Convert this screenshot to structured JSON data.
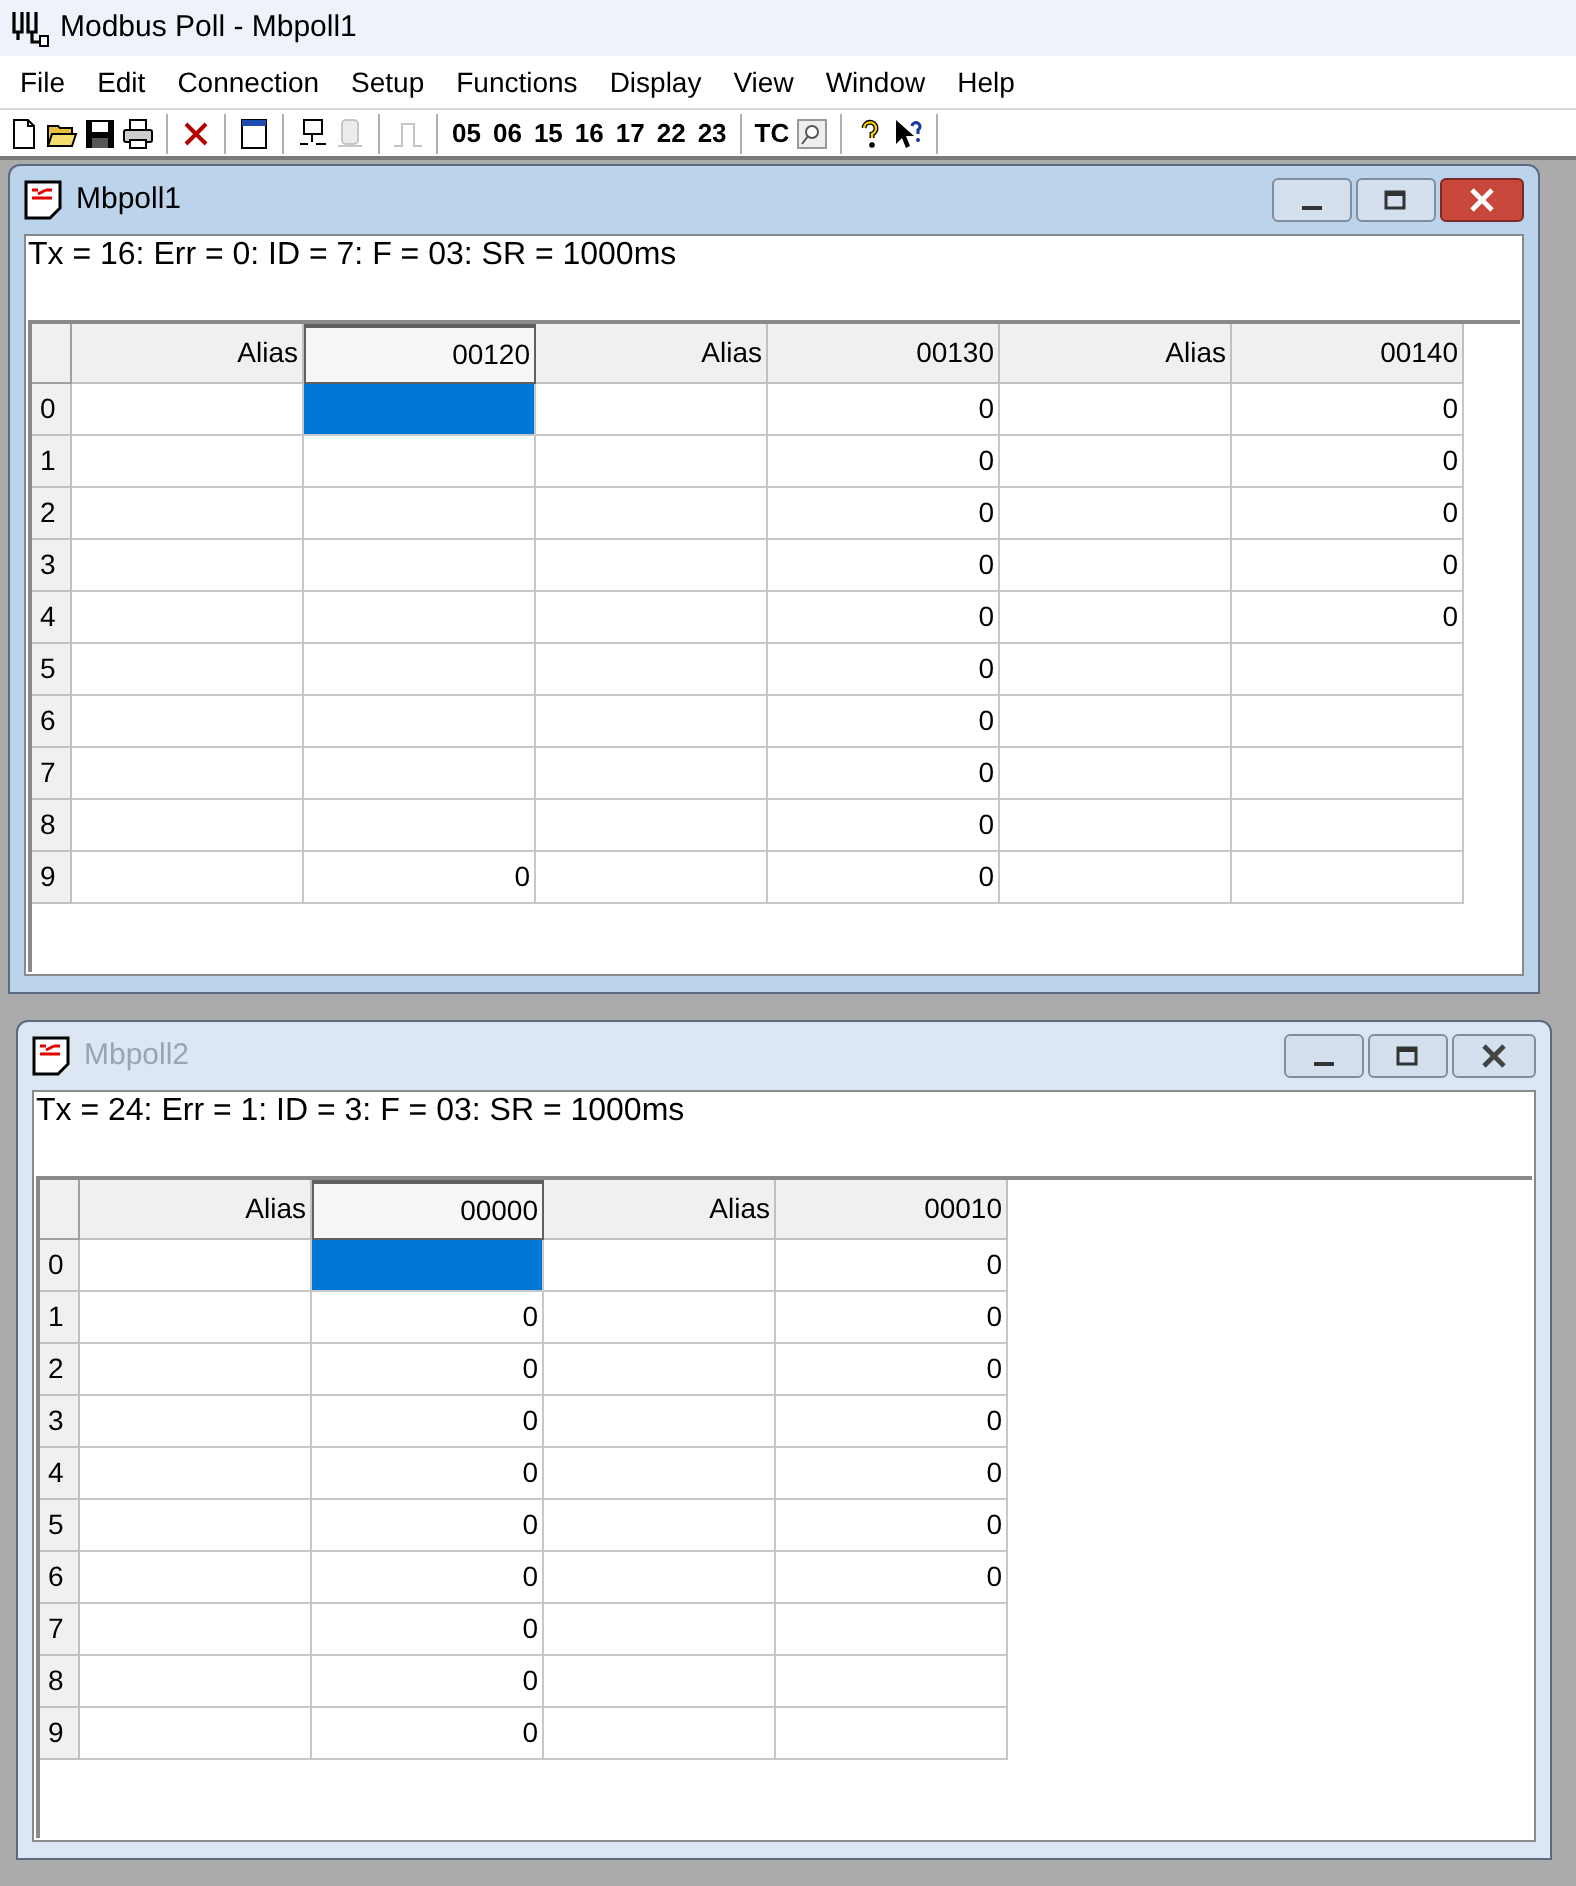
{
  "app_title": "Modbus Poll - Mbpoll1",
  "menu": [
    "File",
    "Edit",
    "Connection",
    "Setup",
    "Functions",
    "Display",
    "View",
    "Window",
    "Help"
  ],
  "toolbar": {
    "icons": [
      {
        "disabled": false
      },
      {
        "disabled": false
      },
      {
        "disabled": false
      },
      {
        "disabled": false
      },
      {
        "disabled": false
      },
      {
        "disabled": false
      },
      {
        "disabled": false
      },
      {
        "disabled": true
      },
      {
        "disabled": true
      }
    ],
    "function_codes": [
      "05",
      "06",
      "15",
      "16",
      "17",
      "22",
      "23"
    ],
    "text_button": "TC",
    "tail_icons": [
      {
        "disabled": false
      },
      {
        "disabled": false
      },
      {
        "disabled": false
      }
    ]
  },
  "windows": [
    {
      "title": "Mbpoll1",
      "active": true,
      "status": "Tx = 16: Err = 0: ID = 7: F = 03: SR = 1000ms",
      "columns": [
        {
          "label": "Alias",
          "selected": false
        },
        {
          "label": "00120",
          "selected": true
        },
        {
          "label": "Alias",
          "selected": false
        },
        {
          "label": "00130",
          "selected": false
        },
        {
          "label": "Alias",
          "selected": false
        },
        {
          "label": "00140",
          "selected": false
        }
      ],
      "rows": [
        {
          "label": "0",
          "cells": [
            {
              "selected": false
            },
            {
              "selected": true
            },
            {
              "selected": false
            },
            {
              "value": "0",
              "selected": false
            },
            {
              "selected": false
            },
            {
              "value": "0",
              "selected": false
            }
          ]
        },
        {
          "label": "1",
          "cells": [
            {
              "selected": false
            },
            {
              "selected": false
            },
            {
              "selected": false
            },
            {
              "value": "0",
              "selected": false
            },
            {
              "selected": false
            },
            {
              "value": "0",
              "selected": false
            }
          ]
        },
        {
          "label": "2",
          "cells": [
            {
              "selected": false
            },
            {
              "selected": false
            },
            {
              "selected": false
            },
            {
              "value": "0",
              "selected": false
            },
            {
              "selected": false
            },
            {
              "value": "0",
              "selected": false
            }
          ]
        },
        {
          "label": "3",
          "cells": [
            {
              "selected": false
            },
            {
              "selected": false
            },
            {
              "selected": false
            },
            {
              "value": "0",
              "selected": false
            },
            {
              "selected": false
            },
            {
              "value": "0",
              "selected": false
            }
          ]
        },
        {
          "label": "4",
          "cells": [
            {
              "selected": false
            },
            {
              "selected": false
            },
            {
              "selected": false
            },
            {
              "value": "0",
              "selected": false
            },
            {
              "selected": false
            },
            {
              "value": "0",
              "selected": false
            }
          ]
        },
        {
          "label": "5",
          "cells": [
            {
              "selected": false
            },
            {
              "selected": false
            },
            {
              "selected": false
            },
            {
              "value": "0",
              "selected": false
            },
            {
              "selected": false
            },
            {
              "selected": false
            }
          ]
        },
        {
          "label": "6",
          "cells": [
            {
              "selected": false
            },
            {
              "selected": false
            },
            {
              "selected": false
            },
            {
              "value": "0",
              "selected": false
            },
            {
              "selected": false
            },
            {
              "selected": false
            }
          ]
        },
        {
          "label": "7",
          "cells": [
            {
              "selected": false
            },
            {
              "selected": false
            },
            {
              "selected": false
            },
            {
              "value": "0",
              "selected": false
            },
            {
              "selected": false
            },
            {
              "selected": false
            }
          ]
        },
        {
          "label": "8",
          "cells": [
            {
              "selected": false
            },
            {
              "selected": false
            },
            {
              "selected": false
            },
            {
              "value": "0",
              "selected": false
            },
            {
              "selected": false
            },
            {
              "selected": false
            }
          ]
        },
        {
          "label": "9",
          "cells": [
            {
              "selected": false
            },
            {
              "value": "0",
              "selected": false
            },
            {
              "selected": false
            },
            {
              "value": "0",
              "selected": false
            },
            {
              "selected": false
            },
            {
              "selected": false
            }
          ]
        }
      ]
    },
    {
      "title": "Mbpoll2",
      "active": false,
      "status": "Tx = 24: Err = 1: ID = 3: F = 03: SR = 1000ms",
      "columns": [
        {
          "label": "Alias",
          "selected": false
        },
        {
          "label": "00000",
          "selected": true
        },
        {
          "label": "Alias",
          "selected": false
        },
        {
          "label": "00010",
          "selected": false
        }
      ],
      "rows": [
        {
          "label": "0",
          "cells": [
            {
              "selected": false
            },
            {
              "selected": true
            },
            {
              "selected": false
            },
            {
              "value": "0",
              "selected": false
            }
          ]
        },
        {
          "label": "1",
          "cells": [
            {
              "selected": false
            },
            {
              "value": "0",
              "selected": false
            },
            {
              "selected": false
            },
            {
              "value": "0",
              "selected": false
            }
          ]
        },
        {
          "label": "2",
          "cells": [
            {
              "selected": false
            },
            {
              "value": "0",
              "selected": false
            },
            {
              "selected": false
            },
            {
              "value": "0",
              "selected": false
            }
          ]
        },
        {
          "label": "3",
          "cells": [
            {
              "selected": false
            },
            {
              "value": "0",
              "selected": false
            },
            {
              "selected": false
            },
            {
              "value": "0",
              "selected": false
            }
          ]
        },
        {
          "label": "4",
          "cells": [
            {
              "selected": false
            },
            {
              "value": "0",
              "selected": false
            },
            {
              "selected": false
            },
            {
              "value": "0",
              "selected": false
            }
          ]
        },
        {
          "label": "5",
          "cells": [
            {
              "selected": false
            },
            {
              "value": "0",
              "selected": false
            },
            {
              "selected": false
            },
            {
              "value": "0",
              "selected": false
            }
          ]
        },
        {
          "label": "6",
          "cells": [
            {
              "selected": false
            },
            {
              "value": "0",
              "selected": false
            },
            {
              "selected": false
            },
            {
              "value": "0",
              "selected": false
            }
          ]
        },
        {
          "label": "7",
          "cells": [
            {
              "selected": false
            },
            {
              "value": "0",
              "selected": false
            },
            {
              "selected": false
            },
            {
              "selected": false
            }
          ]
        },
        {
          "label": "8",
          "cells": [
            {
              "selected": false
            },
            {
              "value": "0",
              "selected": false
            },
            {
              "selected": false
            },
            {
              "selected": false
            }
          ]
        },
        {
          "label": "9",
          "cells": [
            {
              "selected": false
            },
            {
              "value": "0",
              "selected": false
            },
            {
              "selected": false
            },
            {
              "selected": false
            }
          ]
        }
      ]
    }
  ]
}
